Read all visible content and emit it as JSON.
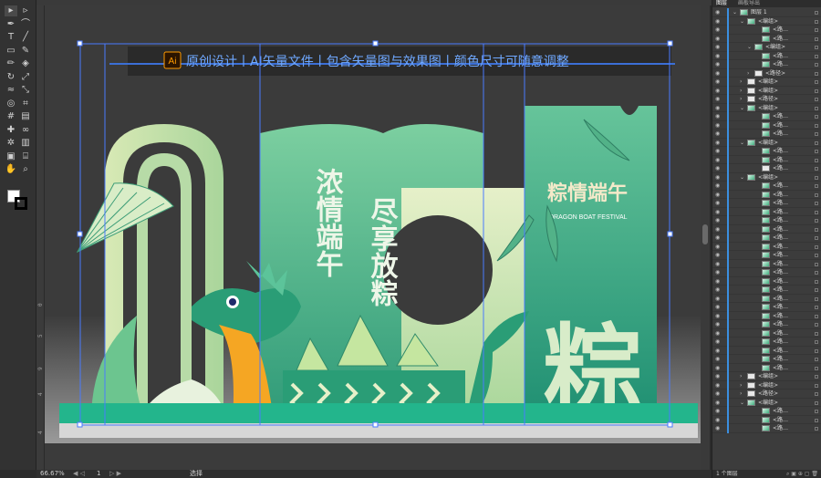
{
  "canvas": {
    "banner_text": "原创设计丨AI矢量文件丨包含矢量图与效果图丨颜色尺寸可随意调整",
    "ai_badge": "Ai",
    "poem_col1": "浓情端午",
    "poem_col2": "尽享放粽",
    "title": "粽情端午",
    "subtitle": "DRAGON BOAT FESTIVAL",
    "big_char": "粽",
    "ruler_labels": [
      "0",
      "5",
      "9",
      "4",
      "4"
    ]
  },
  "status": {
    "zoom": "66.67%",
    "page": "1",
    "mode": "选择"
  },
  "layers_panel": {
    "tab1": "图层",
    "tab2": "画板导出",
    "rows": [
      {
        "label": "图层 1",
        "indent": 0,
        "expanded": true,
        "thumb": "layer"
      },
      {
        "label": "<编组>",
        "indent": 1,
        "expanded": true,
        "thumb": "g"
      },
      {
        "label": "<路…",
        "indent": 3,
        "expanded": false,
        "thumb": "g"
      },
      {
        "label": "<路…",
        "indent": 3,
        "expanded": false,
        "thumb": "g"
      },
      {
        "label": "<编组>",
        "indent": 2,
        "expanded": true,
        "thumb": "g"
      },
      {
        "label": "<路…",
        "indent": 3,
        "expanded": false,
        "thumb": "g"
      },
      {
        "label": "<路…",
        "indent": 3,
        "expanded": false,
        "thumb": "g"
      },
      {
        "label": "<路径>",
        "indent": 2,
        "expanded": false,
        "thumb": "w"
      },
      {
        "label": "<编组>",
        "indent": 1,
        "expanded": false,
        "thumb": "w"
      },
      {
        "label": "<编组>",
        "indent": 1,
        "expanded": false,
        "thumb": "w"
      },
      {
        "label": "<路径>",
        "indent": 1,
        "expanded": false,
        "thumb": "w"
      },
      {
        "label": "<编组>",
        "indent": 1,
        "expanded": true,
        "thumb": "g"
      },
      {
        "label": "<路…",
        "indent": 3,
        "expanded": false,
        "thumb": "g"
      },
      {
        "label": "<路…",
        "indent": 3,
        "expanded": false,
        "thumb": "g"
      },
      {
        "label": "<路…",
        "indent": 3,
        "expanded": false,
        "thumb": "g"
      },
      {
        "label": "<编组>",
        "indent": 1,
        "expanded": true,
        "thumb": "g"
      },
      {
        "label": "<路…",
        "indent": 3,
        "expanded": false,
        "thumb": "g"
      },
      {
        "label": "<路…",
        "indent": 3,
        "expanded": false,
        "thumb": "g"
      },
      {
        "label": "<路…",
        "indent": 3,
        "expanded": false,
        "thumb": "w"
      },
      {
        "label": "<编组>",
        "indent": 1,
        "expanded": true,
        "thumb": "g"
      },
      {
        "label": "<路…",
        "indent": 3,
        "expanded": false,
        "thumb": "g"
      },
      {
        "label": "<路…",
        "indent": 3,
        "expanded": false,
        "thumb": "g"
      },
      {
        "label": "<路…",
        "indent": 3,
        "expanded": false,
        "thumb": "g"
      },
      {
        "label": "<路…",
        "indent": 3,
        "expanded": false,
        "thumb": "g"
      },
      {
        "label": "<路…",
        "indent": 3,
        "expanded": false,
        "thumb": "g"
      },
      {
        "label": "<路…",
        "indent": 3,
        "expanded": false,
        "thumb": "g"
      },
      {
        "label": "<路…",
        "indent": 3,
        "expanded": false,
        "thumb": "g"
      },
      {
        "label": "<路…",
        "indent": 3,
        "expanded": false,
        "thumb": "g"
      },
      {
        "label": "<路…",
        "indent": 3,
        "expanded": false,
        "thumb": "g"
      },
      {
        "label": "<路…",
        "indent": 3,
        "expanded": false,
        "thumb": "g"
      },
      {
        "label": "<路…",
        "indent": 3,
        "expanded": false,
        "thumb": "g"
      },
      {
        "label": "<路…",
        "indent": 3,
        "expanded": false,
        "thumb": "g"
      },
      {
        "label": "<路…",
        "indent": 3,
        "expanded": false,
        "thumb": "g"
      },
      {
        "label": "<路…",
        "indent": 3,
        "expanded": false,
        "thumb": "g"
      },
      {
        "label": "<路…",
        "indent": 3,
        "expanded": false,
        "thumb": "g"
      },
      {
        "label": "<路…",
        "indent": 3,
        "expanded": false,
        "thumb": "g"
      },
      {
        "label": "<路…",
        "indent": 3,
        "expanded": false,
        "thumb": "g"
      },
      {
        "label": "<路…",
        "indent": 3,
        "expanded": false,
        "thumb": "g"
      },
      {
        "label": "<路…",
        "indent": 3,
        "expanded": false,
        "thumb": "g"
      },
      {
        "label": "<路…",
        "indent": 3,
        "expanded": false,
        "thumb": "g"
      },
      {
        "label": "<路…",
        "indent": 3,
        "expanded": false,
        "thumb": "g"
      },
      {
        "label": "<路…",
        "indent": 3,
        "expanded": false,
        "thumb": "g"
      },
      {
        "label": "<编组>",
        "indent": 1,
        "expanded": false,
        "thumb": "w"
      },
      {
        "label": "<编组>",
        "indent": 1,
        "expanded": false,
        "thumb": "w"
      },
      {
        "label": "<路径>",
        "indent": 1,
        "expanded": false,
        "thumb": "w"
      },
      {
        "label": "<编组>",
        "indent": 1,
        "expanded": true,
        "thumb": "g"
      },
      {
        "label": "<路…",
        "indent": 3,
        "expanded": false,
        "thumb": "g"
      },
      {
        "label": "<路…",
        "indent": 3,
        "expanded": false,
        "thumb": "g"
      },
      {
        "label": "<路…",
        "indent": 3,
        "expanded": false,
        "thumb": "g"
      }
    ],
    "footer": "1 个图层"
  },
  "colors": {
    "accent_blue": "#3b8fe0",
    "mint": "#3fae7e",
    "teal_floor": "#23b58c"
  },
  "tools": [
    "selection-tool",
    "direct-selection-tool",
    "pen-tool",
    "curvature-tool",
    "type-tool",
    "line-tool",
    "rectangle-tool",
    "paintbrush-tool",
    "pencil-tool",
    "eraser-tool",
    "rotate-tool",
    "scale-tool",
    "width-tool",
    "free-transform-tool",
    "shape-builder-tool",
    "perspective-tool",
    "mesh-tool",
    "gradient-tool",
    "eyedropper-tool",
    "blend-tool",
    "symbol-sprayer-tool",
    "graph-tool",
    "artboard-tool",
    "slice-tool",
    "hand-tool",
    "zoom-tool"
  ]
}
